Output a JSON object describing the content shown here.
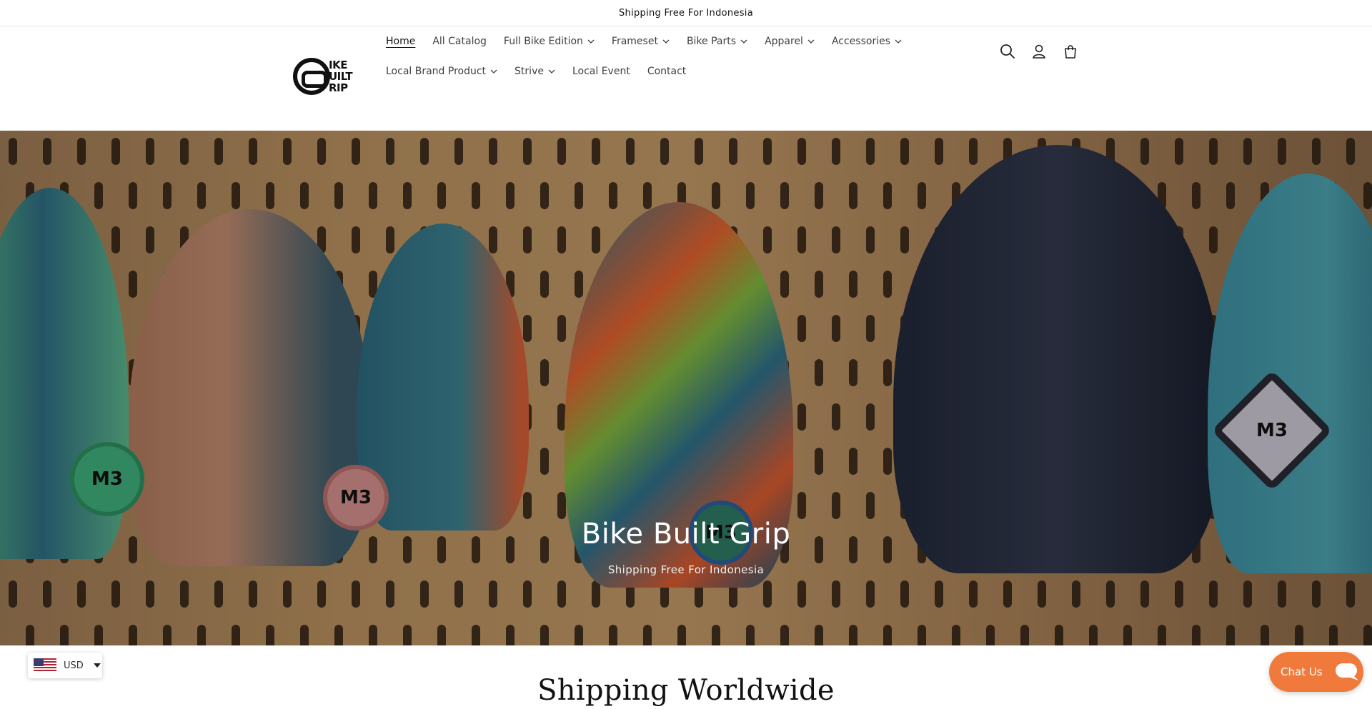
{
  "announcement": {
    "text": "Shipping Free For Indonesia"
  },
  "logo": {
    "text_lines": [
      "IKE",
      "UILT",
      "RIP"
    ]
  },
  "nav": {
    "row1": [
      {
        "label": "Home",
        "active": true,
        "has_dropdown": false
      },
      {
        "label": "All Catalog",
        "active": false,
        "has_dropdown": false
      },
      {
        "label": "Full Bike Edition",
        "active": false,
        "has_dropdown": true
      },
      {
        "label": "Frameset",
        "active": false,
        "has_dropdown": true
      },
      {
        "label": "Bike Parts",
        "active": false,
        "has_dropdown": true
      },
      {
        "label": "Apparel",
        "active": false,
        "has_dropdown": true
      },
      {
        "label": "Accessories",
        "active": false,
        "has_dropdown": true
      }
    ],
    "row2": [
      {
        "label": "Local Brand Product",
        "active": false,
        "has_dropdown": true
      },
      {
        "label": "Strive",
        "active": false,
        "has_dropdown": true
      },
      {
        "label": "Local Event",
        "active": false,
        "has_dropdown": false
      },
      {
        "label": "Contact",
        "active": false,
        "has_dropdown": false
      }
    ]
  },
  "header_icons": [
    "search-icon",
    "account-icon",
    "cart-icon"
  ],
  "hero": {
    "title": "Bike Built Grip",
    "subtitle": "Shipping Free For Indonesia",
    "tag_text": "M3"
  },
  "section": {
    "title": "Shipping Worldwide"
  },
  "currency": {
    "code": "USD",
    "flag": "us-flag-icon"
  },
  "chat": {
    "label": "Chat Us",
    "color": "#ef7a3c"
  }
}
